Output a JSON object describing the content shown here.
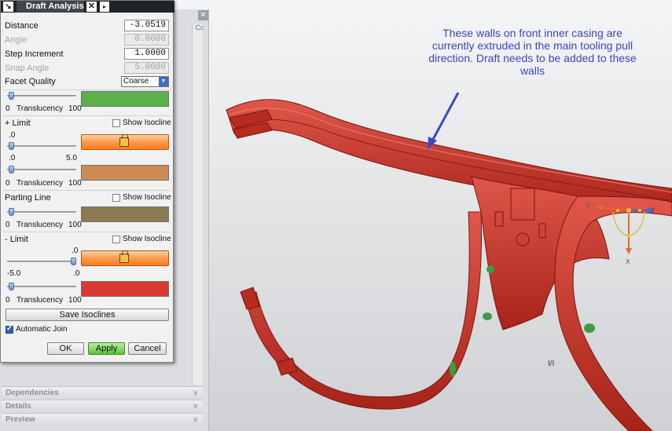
{
  "dialog": {
    "title": "Draft Analysis",
    "close_glyph": "✕",
    "next_glyph": "▸",
    "menu_glyph": "↘",
    "distance_label": "Distance",
    "distance_value": "-3.0519",
    "angle_label": "Angle",
    "angle_value": "0.0000",
    "step_label": "Step Increment",
    "step_value": "1.0000",
    "snap_label": "Snap Angle",
    "snap_value": "5.0000",
    "facet_label": "Facet Quality",
    "facet_value": "Coarse",
    "translucency_label": "Translucency",
    "t_min": "0",
    "t_max": "100",
    "plus_limit_label": "+ Limit",
    "show_isocline_label": "Show Isocline",
    "plus_lo": ".0",
    "plus_range_lo": ".0",
    "plus_range_hi": "5.0",
    "parting_line_label": "Parting Line",
    "minus_limit_label": "- Limit",
    "minus_hi": ".0",
    "minus_range_lo": "-5.0",
    "minus_range_hi": ".0",
    "save_isoclines_label": "Save Isoclines",
    "automatic_join_label": "Automatic Join",
    "automatic_join_checked": true,
    "ok_label": "OK",
    "apply_label": "Apply",
    "cancel_label": "Cancel",
    "colors": {
      "translucency_swatch": "#5bb04b",
      "plus_limit_button": "#ff8a36",
      "plus_band": "#cc8a55",
      "parting_line": "#8c7a50",
      "minus_limit_button": "#ff8a36",
      "minus_band": "#d93b33"
    }
  },
  "navigator": {
    "close_glyph": "✕",
    "header_fragment": "Cc",
    "sections": [
      {
        "label": "Dependencies",
        "chevron": "∨"
      },
      {
        "label": "Details",
        "chevron": "∨"
      },
      {
        "label": "Preview",
        "chevron": "∨"
      }
    ]
  },
  "viewport": {
    "annotation": "These walls on front inner casing are currently extruded in the main tooling pull direction. Draft needs to be added to these walls",
    "axes": {
      "x": "X",
      "y": "Y",
      "z": "Z"
    },
    "iso_marker": "I/I",
    "model_color": "#c8382c",
    "arrow_color": "#3d45c8"
  }
}
